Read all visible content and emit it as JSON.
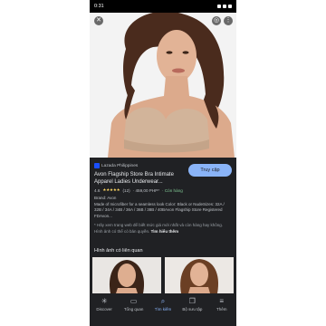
{
  "status_bar": {
    "time": "0:31"
  },
  "image": {
    "alt": "Woman wearing nude strapless bra"
  },
  "source": {
    "name": "Lazada Philippines"
  },
  "visit_button": {
    "label": "Truy cập"
  },
  "product": {
    "title": "Avon Flagship Store Bra Intimate Apparel Ladies Underwear...",
    "rating": "4.6",
    "stars": "★★★★★",
    "reviews": "(12)",
    "price": "· 459,00 PHP*",
    "stock": "· Còn hàng"
  },
  "brand_line": "Brand: Avon",
  "description": "Made of microfiber for a seamless look Color: Black or NudeSizes: 32A / 32B / 34A / 34B / 36A / 36B / 38B / 40BAvon Flagship Store Registered FDAvon...",
  "disclaimer": {
    "text": "* Hãy xem trang web để biết mức giá mới nhất và còn hàng hay không. Hình ảnh có thể có bản quyền.",
    "link": "Tìm hiểu thêm"
  },
  "related": {
    "heading": "Hình ảnh có liên quan"
  },
  "bottom_nav": [
    {
      "label": "Discover",
      "icon": "asterisk-icon"
    },
    {
      "label": "Tổng quan",
      "icon": "inbox-icon"
    },
    {
      "label": "Tìm kiếm",
      "icon": "search-icon"
    },
    {
      "label": "Bộ sưu tập",
      "icon": "bookmark-icon"
    },
    {
      "label": "Thêm",
      "icon": "menu-icon"
    }
  ],
  "colors": {
    "accent": "#8ab4f8",
    "panel": "#202124",
    "skin": "#d9a98a",
    "bra": "#d2b49a"
  }
}
